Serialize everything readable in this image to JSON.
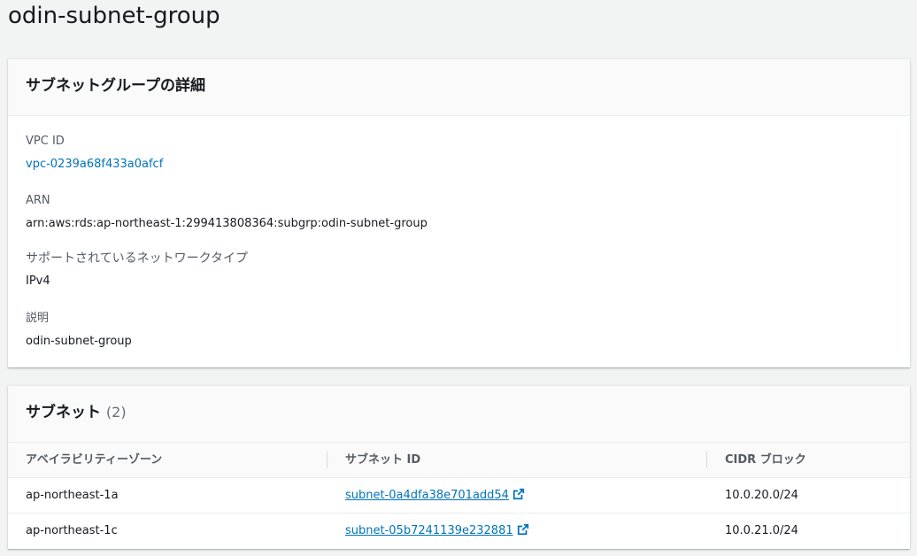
{
  "page": {
    "title": "odin-subnet-group"
  },
  "details": {
    "heading": "サブネットグループの詳細",
    "vpc_id_label": "VPC ID",
    "vpc_id_value": "vpc-0239a68f433a0afcf",
    "arn_label": "ARN",
    "arn_value": "arn:aws:rds:ap-northeast-1:299413808364:subgrp:odin-subnet-group",
    "network_type_label": "サポートされているネットワークタイプ",
    "network_type_value": "IPv4",
    "description_label": "説明",
    "description_value": "odin-subnet-group"
  },
  "subnets": {
    "heading": "サブネット",
    "count": "(2)",
    "columns": [
      "アベイラビリティーゾーン",
      "サブネット ID",
      "CIDR ブロック"
    ],
    "rows": [
      {
        "az": "ap-northeast-1a",
        "subnet_id": "subnet-0a4dfa38e701add54",
        "cidr": "10.0.20.0/24"
      },
      {
        "az": "ap-northeast-1c",
        "subnet_id": "subnet-05b7241139e232881",
        "cidr": "10.0.21.0/24"
      }
    ]
  },
  "icons": {
    "external_link": "external-link-icon"
  },
  "colors": {
    "link": "#0073bb",
    "background": "#f2f3f3",
    "text": "#16191f",
    "label": "#545b64"
  }
}
